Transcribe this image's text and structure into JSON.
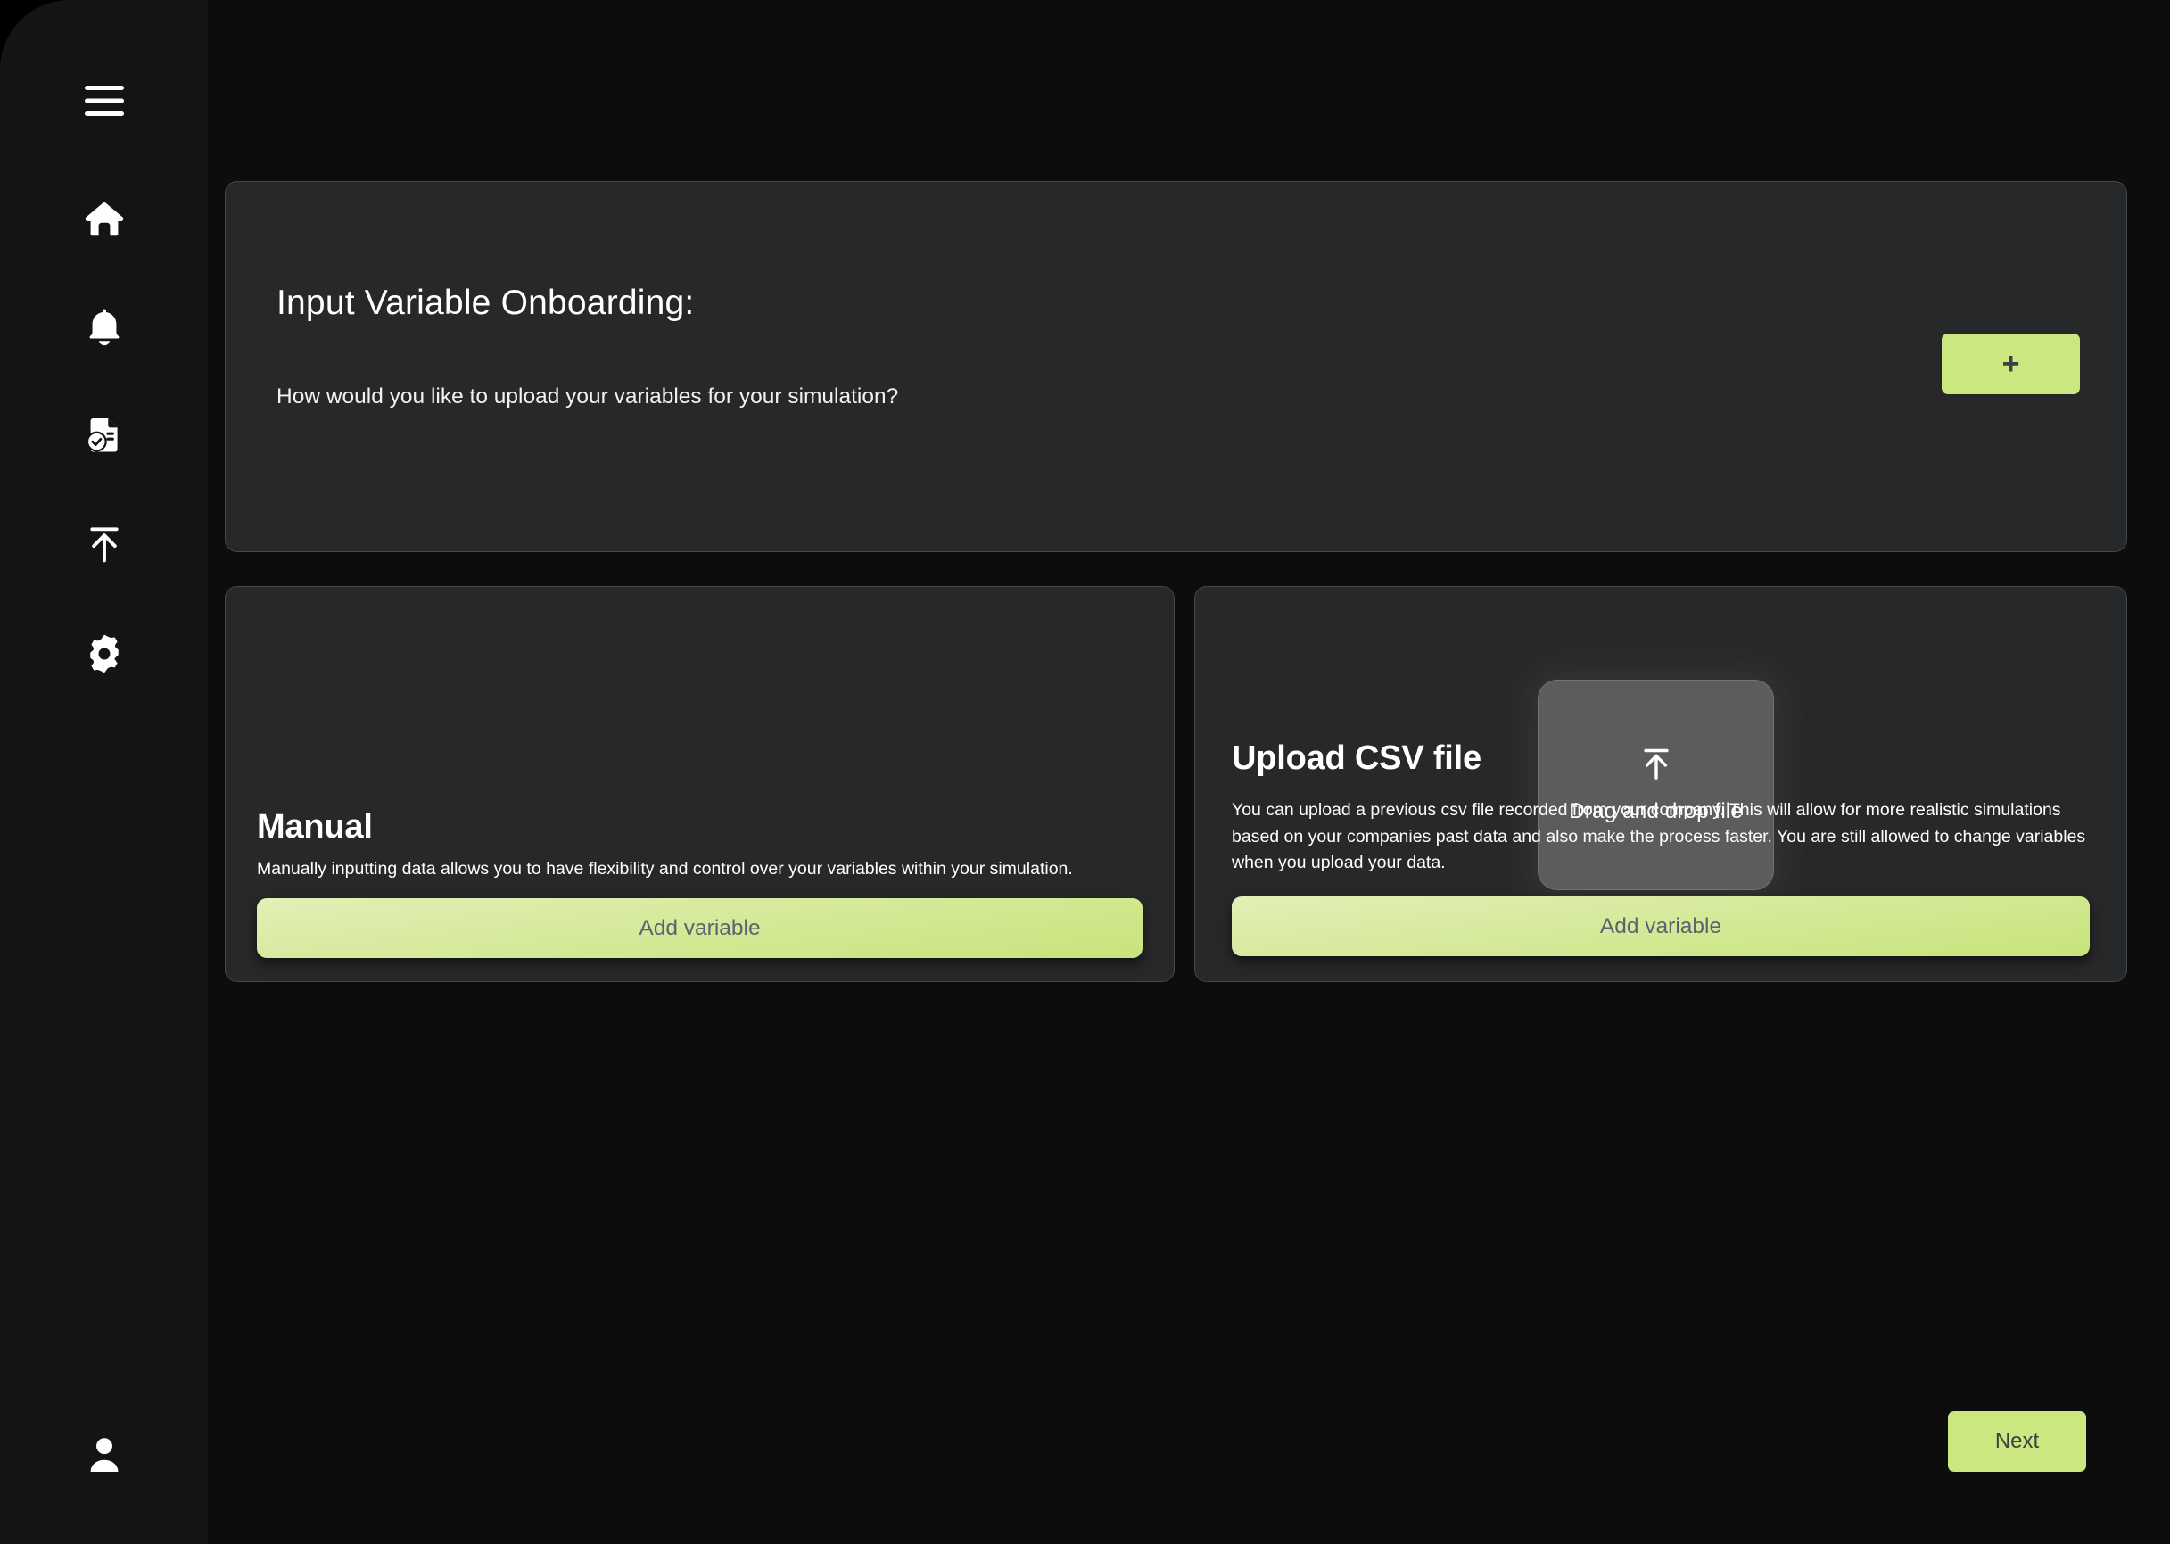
{
  "sidebar": {
    "menu_button": {
      "icon": "hamburger-menu-icon",
      "label": "Menu"
    },
    "items": [
      {
        "icon": "home-icon",
        "label": "Home"
      },
      {
        "icon": "bell-icon",
        "label": "Notifications"
      },
      {
        "icon": "document-check-icon",
        "label": "Reports"
      },
      {
        "icon": "upload-icon",
        "label": "Upload"
      },
      {
        "icon": "gear-icon",
        "label": "Settings"
      }
    ],
    "account": {
      "icon": "user-avatar-icon",
      "label": "Account"
    }
  },
  "header": {
    "title": "Input Variable Onboarding:",
    "question": "How would you like to upload your variables for your simulation?",
    "add_button_label": "+"
  },
  "options": {
    "manual": {
      "title": "Manual",
      "description": "Manually inputting data allows you to have flexibility and control over your variables within your simulation.",
      "button_label": "Add variable"
    },
    "csv": {
      "title": "Upload CSV file",
      "description": "You can upload a previous csv file recorded from your company. This will allow for more realistic simulations based on your companies past data and also make the process faster. You are still allowed to change variables when you upload your data.",
      "button_label": "Add variable",
      "dropzone": {
        "label": "Drag and drop file",
        "icon": "upload-icon"
      }
    }
  },
  "footer": {
    "next_label": "Next"
  },
  "colors": {
    "accent": "#cbe77f",
    "card_background": "#26282a",
    "card_border": "#44484b",
    "sidebar_background": "#141414",
    "main_background": "#0d0d0d",
    "dropzone_background": "#5c5c5c",
    "button_text": "#5c6370"
  }
}
